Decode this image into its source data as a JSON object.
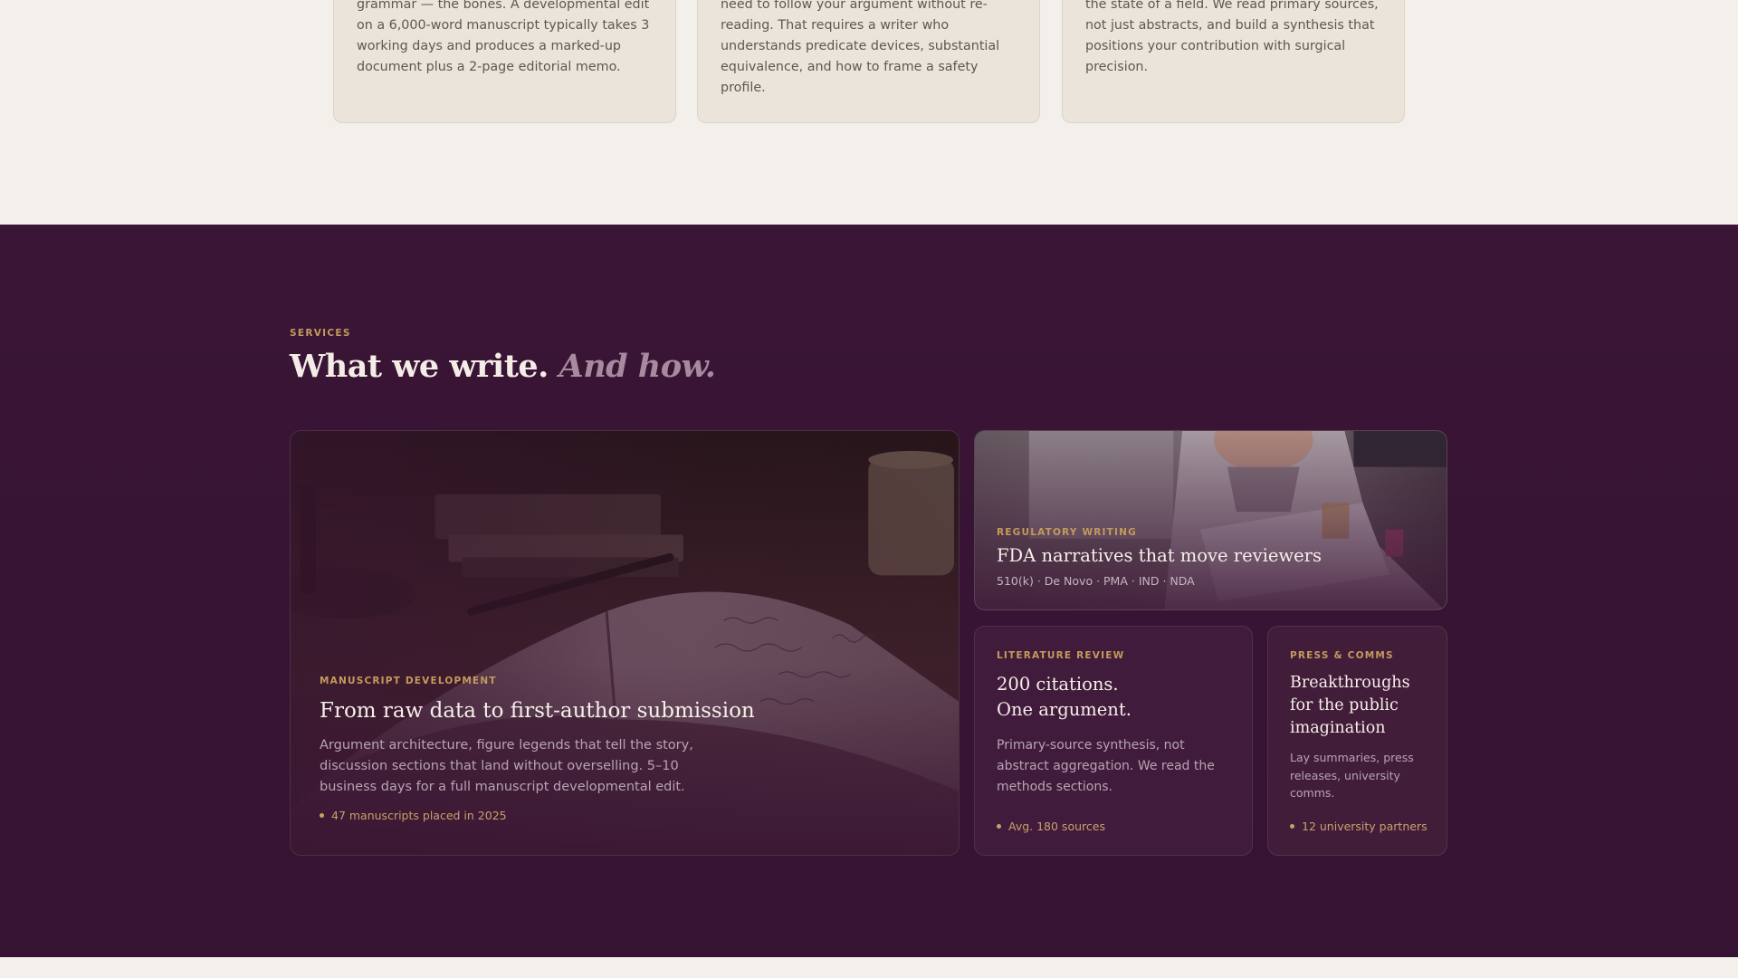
{
  "top_cards": [
    {
      "text": "grammar — the bones. A developmental edit on a 6,000-word manuscript typically takes 3 working days and produces a marked-up document plus a 2-page editorial memo."
    },
    {
      "text": "need to follow your argument without re-reading. That requires a writer who understands predicate devices, substantial equivalence, and how to frame a safety profile."
    },
    {
      "text": "the state of a field. We read primary sources, not just abstracts, and build a synthesis that positions your contribution with surgical precision."
    }
  ],
  "services": {
    "eyebrow": "SERVICES",
    "heading_main": "What we write.",
    "heading_accent": "And how.",
    "cards": {
      "manuscript": {
        "label": "MANUSCRIPT DEVELOPMENT",
        "title": "From raw data to first-author submission",
        "text": "Argument architecture, figure legends that tell the story, discussion sections that land without overselling. 5–10 business days for a full manuscript developmental edit.",
        "meta": "47 manuscripts placed in 2025",
        "image": "open-book-on-desk-photo"
      },
      "regulatory": {
        "label": "REGULATORY WRITING",
        "title": "FDA narratives that move reviewers",
        "sub": "510(k) · De Novo · PMA · IND · NDA",
        "image": "person-reading-document-photo"
      },
      "literature": {
        "label": "LITERATURE REVIEW",
        "title_line1": "200 citations.",
        "title_line2": "One argument.",
        "text": "Primary-source synthesis, not abstract aggregation. We read the methods sections.",
        "meta": "Avg. 180 sources"
      },
      "press": {
        "label": "PRESS & COMMS",
        "title": "Breakthroughs for the public imagination",
        "text": "Lay summaries, press releases, university comms.",
        "meta": "12 university partners"
      }
    }
  },
  "colors": {
    "cream": "#f3efea",
    "plum": "#3a1535",
    "gold": "#c49a5c"
  }
}
